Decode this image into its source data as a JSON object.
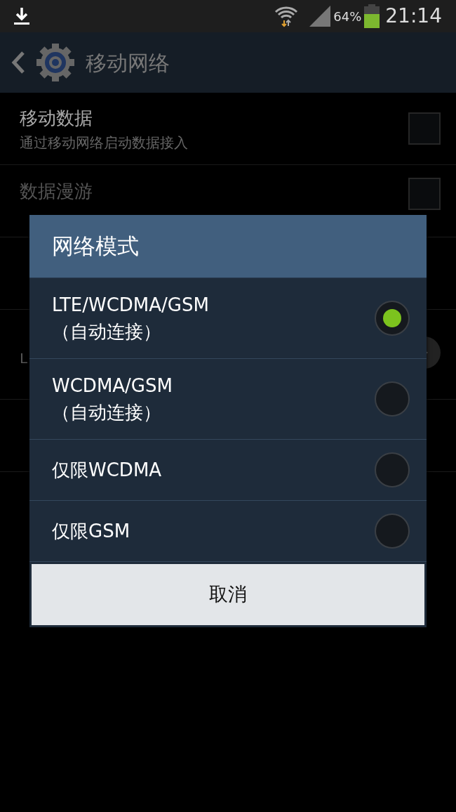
{
  "status_bar": {
    "battery": "64%",
    "time": "21:14"
  },
  "action_bar": {
    "title": "移动网络"
  },
  "settings": [
    {
      "title": "移动数据",
      "subtitle": "通过移动网络启动数据接入",
      "checked": false,
      "disabled": false
    },
    {
      "title": "数据漫游",
      "checked": false,
      "disabled": true
    }
  ],
  "covered_row_text": "L",
  "dialog": {
    "title": "网络模式",
    "options": [
      {
        "label": "LTE/WCDMA/GSM",
        "note": "（自动连接）",
        "selected": true
      },
      {
        "label": "WCDMA/GSM",
        "note": "（自动连接）",
        "selected": false
      },
      {
        "label": "仅限WCDMA",
        "selected": false
      },
      {
        "label": "仅限GSM",
        "selected": false
      }
    ],
    "button": "取消"
  }
}
